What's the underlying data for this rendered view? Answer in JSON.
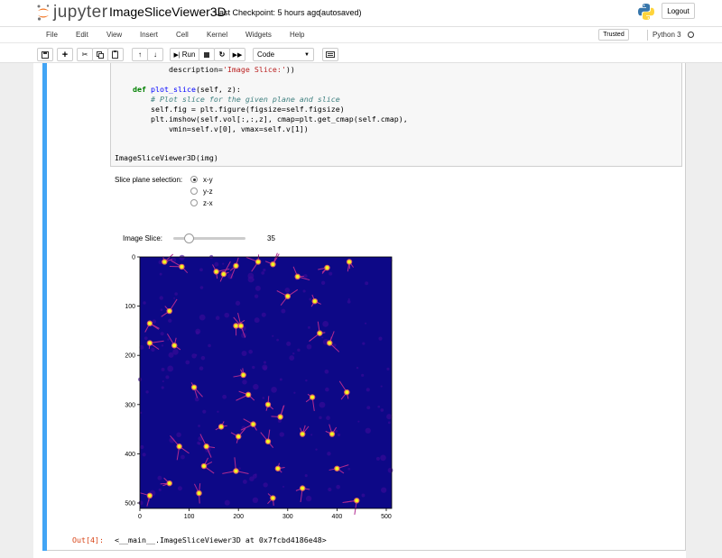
{
  "header": {
    "logo_text": "jupyter",
    "notebook_name": "ImageSliceViewer3D",
    "checkpoint": "Last Checkpoint: 5 hours ago",
    "autosaved": "(autosaved)",
    "logout_label": "Logout"
  },
  "menubar": {
    "items": [
      "File",
      "Edit",
      "View",
      "Insert",
      "Cell",
      "Kernel",
      "Widgets",
      "Help"
    ],
    "trusted_label": "Trusted",
    "kernel_name": "Python 3"
  },
  "toolbar": {
    "run_label": "Run",
    "cell_type": "Code"
  },
  "code": {
    "line1_indent": "            ",
    "line1_text": "description=",
    "line1_str": "'Image Slice:'",
    "line1_end": "))",
    "line2_kw": "def",
    "line2_fn": "plot_slice",
    "line2_rest": "(self, z):",
    "line3_comment": "# Plot slice for the given plane and slice",
    "line4": "self.fig = plt.figure(figsize=self.figsize)",
    "line5": "plt.imshow(self.vol[:,:,z], cmap=plt.get_cmap(self.cmap),",
    "line6": "vmin=self.v[0], vmax=self.v[1])",
    "line8": "ImageSliceViewer3D(img)"
  },
  "widgets": {
    "plane_label": "Slice plane selection:",
    "plane_options": [
      "x-y",
      "y-z",
      "z-x"
    ],
    "selected_plane": "x-y",
    "slice_label": "Image Slice:",
    "slice_value": "35",
    "slice_fraction": 0.068
  },
  "output": {
    "prompt": "Out[4]:",
    "text": "<__main__.ImageSliceViewer3D at 0x7fcbd4186e48>"
  },
  "chart_data": {
    "type": "heatmap",
    "title": "",
    "xlabel": "",
    "ylabel": "",
    "x_ticks": [
      0,
      100,
      200,
      300,
      400,
      500
    ],
    "y_ticks": [
      0,
      100,
      200,
      300,
      400,
      500
    ],
    "xlim": [
      0,
      511
    ],
    "ylim": [
      511,
      0
    ],
    "colormap": "plasma",
    "background_color": "#0d0887",
    "bright_spots": [
      [
        50,
        10
      ],
      [
        85,
        20
      ],
      [
        155,
        30
      ],
      [
        195,
        18
      ],
      [
        170,
        35
      ],
      [
        240,
        10
      ],
      [
        270,
        15
      ],
      [
        320,
        40
      ],
      [
        380,
        22
      ],
      [
        425,
        10
      ],
      [
        355,
        90
      ],
      [
        20,
        135
      ],
      [
        60,
        110
      ],
      [
        195,
        140
      ],
      [
        205,
        140
      ],
      [
        300,
        80
      ],
      [
        365,
        155
      ],
      [
        20,
        175
      ],
      [
        70,
        180
      ],
      [
        385,
        175
      ],
      [
        210,
        240
      ],
      [
        110,
        265
      ],
      [
        220,
        280
      ],
      [
        260,
        300
      ],
      [
        350,
        285
      ],
      [
        420,
        275
      ],
      [
        165,
        345
      ],
      [
        230,
        340
      ],
      [
        285,
        325
      ],
      [
        80,
        385
      ],
      [
        135,
        385
      ],
      [
        200,
        365
      ],
      [
        260,
        375
      ],
      [
        330,
        360
      ],
      [
        390,
        360
      ],
      [
        130,
        425
      ],
      [
        60,
        460
      ],
      [
        195,
        435
      ],
      [
        280,
        430
      ],
      [
        400,
        430
      ],
      [
        20,
        485
      ],
      [
        120,
        480
      ],
      [
        270,
        490
      ],
      [
        330,
        470
      ],
      [
        440,
        495
      ]
    ]
  }
}
